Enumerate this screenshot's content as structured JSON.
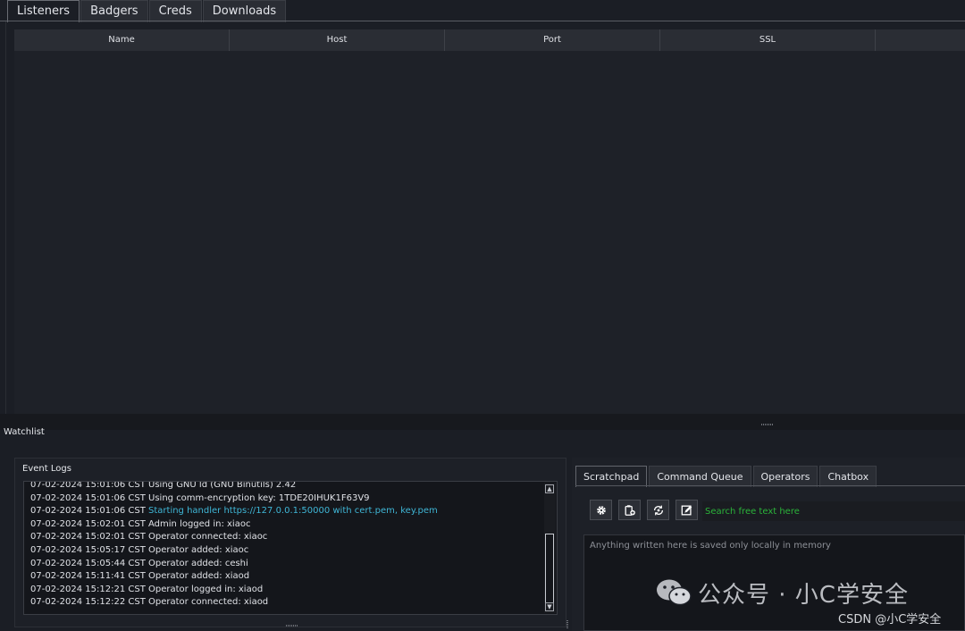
{
  "top_tabs": [
    {
      "label": "Listeners",
      "active": true
    },
    {
      "label": "Badgers",
      "active": false
    },
    {
      "label": "Creds",
      "active": false
    },
    {
      "label": "Downloads",
      "active": false
    }
  ],
  "table": {
    "columns": [
      "Name",
      "Host",
      "Port",
      "SSL"
    ]
  },
  "watchlist_label": "Watchlist",
  "event_logs": {
    "title": "Event Logs",
    "lines": [
      {
        "prefix": "07-02-2024 15:01:06 CST ",
        "text": "Using GNU ld (GNU Binutils) 2.42",
        "highlight": false
      },
      {
        "prefix": "07-02-2024 15:01:06 CST ",
        "text": "Using comm-encryption key: 1TDE20IHUK1F63V9",
        "highlight": false
      },
      {
        "prefix": "07-02-2024 15:01:06 CST ",
        "text": "Starting handler https://127.0.0.1:50000 with cert.pem, key.pem",
        "highlight": true
      },
      {
        "prefix": "07-02-2024 15:02:01 CST ",
        "text": "Admin logged in: xiaoc",
        "highlight": false
      },
      {
        "prefix": "07-02-2024 15:02:01 CST ",
        "text": "Operator connected: xiaoc",
        "highlight": false
      },
      {
        "prefix": "07-02-2024 15:05:17 CST ",
        "text": "Operator added: xiaoc",
        "highlight": false
      },
      {
        "prefix": "07-02-2024 15:05:44 CST ",
        "text": "Operator added: ceshi",
        "highlight": false
      },
      {
        "prefix": "07-02-2024 15:11:41 CST ",
        "text": "Operator added: xiaod",
        "highlight": false
      },
      {
        "prefix": "07-02-2024 15:12:21 CST ",
        "text": "Operator logged in: xiaod",
        "highlight": false
      },
      {
        "prefix": "07-02-2024 15:12:22 CST ",
        "text": "Operator connected: xiaod",
        "highlight": false
      }
    ]
  },
  "right_tabs": [
    {
      "label": "Scratchpad",
      "active": true
    },
    {
      "label": "Command Queue",
      "active": false
    },
    {
      "label": "Operators",
      "active": false
    },
    {
      "label": "Chatbox",
      "active": false
    }
  ],
  "toolbar_icons": [
    "gear-icon",
    "clipboard-add-icon",
    "refresh-icon",
    "edit-icon"
  ],
  "search": {
    "placeholder": "Search free text here"
  },
  "scratchpad": {
    "placeholder": "Anything written here is saved only locally in memory"
  },
  "watermark": {
    "text": "公众号 · 小C学安全",
    "credit": "CSDN @小C学安全"
  },
  "colors": {
    "background": "#1b1e25",
    "highlight_log": "#3fb6d6",
    "search_text": "#2bb33a"
  }
}
